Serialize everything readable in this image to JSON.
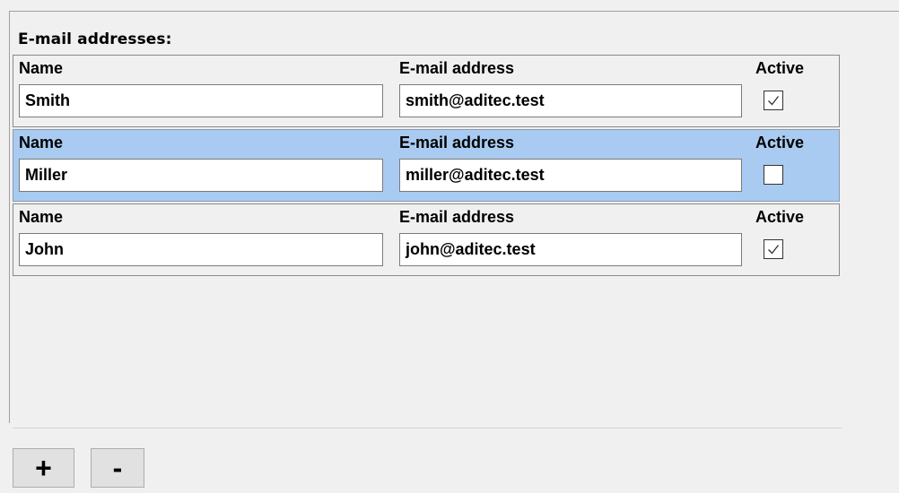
{
  "section": {
    "title": "E-mail addresses:"
  },
  "columns": {
    "name": "Name",
    "email": "E-mail address",
    "active": "Active"
  },
  "entries": [
    {
      "name": "Smith",
      "email": "smith@aditec.test",
      "active": true,
      "selected": false
    },
    {
      "name": "Miller",
      "email": "miller@aditec.test",
      "active": false,
      "selected": true
    },
    {
      "name": "John",
      "email": "john@aditec.test",
      "active": true,
      "selected": false
    }
  ],
  "buttons": {
    "add_label": "+",
    "remove_label": "-"
  },
  "colors": {
    "selected_row": "#a9cbf1",
    "background": "#f0f0f0"
  }
}
